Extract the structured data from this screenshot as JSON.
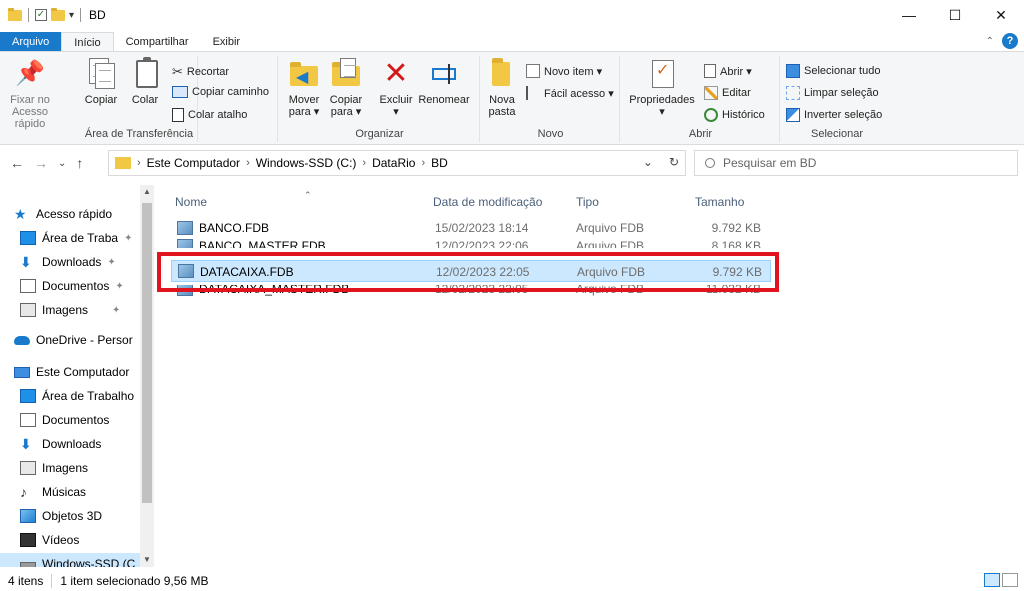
{
  "window": {
    "title": "BD",
    "minimize": "—",
    "maximize": "☐",
    "close": "✕"
  },
  "ribbon_tabs": [
    {
      "label": "Arquivo"
    },
    {
      "label": "Início"
    },
    {
      "label": "Compartilhar"
    },
    {
      "label": "Exibir"
    }
  ],
  "ribbon": {
    "clipboard": {
      "label": "Área de Transferência",
      "pin": "Fixar no Acesso rápido",
      "copy": "Copiar",
      "paste": "Colar",
      "cut": "Recortar",
      "copy_path": "Copiar caminho",
      "paste_shortcut": "Colar atalho"
    },
    "organize": {
      "label": "Organizar",
      "move_to": "Mover para ▾",
      "copy_to": "Copiar para ▾",
      "delete": "Excluir ▾",
      "rename": "Renomear"
    },
    "new": {
      "label": "Novo",
      "new_folder": "Nova pasta",
      "new_item": "Novo item ▾",
      "easy_access": "Fácil acesso ▾"
    },
    "open": {
      "label": "Abrir",
      "properties": "Propriedades ▾",
      "open": "Abrir ▾",
      "edit": "Editar",
      "history": "Histórico"
    },
    "select": {
      "label": "Selecionar",
      "select_all": "Selecionar tudo",
      "select_none": "Limpar seleção",
      "invert": "Inverter seleção"
    }
  },
  "address": {
    "crumbs": [
      "Este Computador",
      "Windows-SSD (C:)",
      "DataRio",
      "BD"
    ],
    "search_placeholder": "Pesquisar em BD"
  },
  "sidebar": [
    {
      "label": "Acesso rápido",
      "icon": "star-icon"
    },
    {
      "label": "Área de Traba",
      "icon": "desktop-icon",
      "pinned": true
    },
    {
      "label": "Downloads",
      "icon": "download-icon",
      "pinned": true
    },
    {
      "label": "Documentos",
      "icon": "documents-icon",
      "pinned": true
    },
    {
      "label": "Imagens",
      "icon": "images-icon",
      "pinned": true
    },
    {
      "label": "OneDrive - Persor",
      "icon": "cloud-icon"
    },
    {
      "label": "Este Computador",
      "icon": "computer-icon"
    },
    {
      "label": "Área de Trabalho",
      "icon": "desktop-icon"
    },
    {
      "label": "Documentos",
      "icon": "documents-icon"
    },
    {
      "label": "Downloads",
      "icon": "download-icon"
    },
    {
      "label": "Imagens",
      "icon": "images-icon"
    },
    {
      "label": "Músicas",
      "icon": "music-icon"
    },
    {
      "label": "Objetos 3D",
      "icon": "objects-3d-icon"
    },
    {
      "label": "Vídeos",
      "icon": "video-icon"
    },
    {
      "label": "Windows-SSD (C",
      "icon": "drive-icon"
    }
  ],
  "columns": {
    "name": "Nome",
    "date": "Data de modificação",
    "type": "Tipo",
    "size": "Tamanho"
  },
  "files": [
    {
      "name": "BANCO.FDB",
      "date": "15/02/2023 18:14",
      "type": "Arquivo FDB",
      "size": "9.792 KB",
      "selected": false
    },
    {
      "name": "BANCO_MASTER.FDB",
      "date": "12/02/2023 22:06",
      "type": "Arquivo FDB",
      "size": "8.168 KB",
      "selected": false
    },
    {
      "name": "DATACAIXA.FDB",
      "date": "12/02/2023 22:05",
      "type": "Arquivo FDB",
      "size": "9.792 KB",
      "selected": true
    },
    {
      "name": "DATACAIXA_MASTER.FDB",
      "date": "12/02/2023 22:05",
      "type": "Arquivo FDB",
      "size": "11.032 KB",
      "selected": false
    }
  ],
  "status": {
    "items": "4 itens",
    "selection": "1 item selecionado  9,56 MB"
  },
  "colors": {
    "accent": "#1979ca",
    "selection": "#cce8ff",
    "highlight": "#e0141e"
  }
}
